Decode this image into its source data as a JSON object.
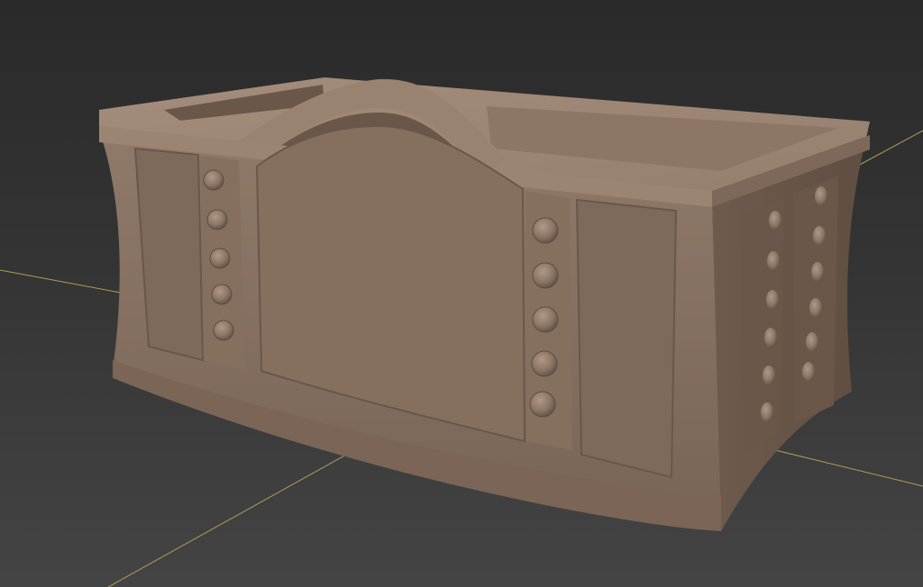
{
  "viewport": {
    "background_top": "#2a2a2a",
    "background_bottom": "#444444",
    "grid_axis_color": "#b59a5a"
  },
  "model": {
    "object": "planter-box",
    "base_color": "#8a7565",
    "highlight_color": "#a89080",
    "shadow_color": "#5e4d40",
    "front_rivet_columns": 2,
    "front_rivets_per_column": 5,
    "side_rivet_columns": 2,
    "side_rivets_per_column": 6
  }
}
